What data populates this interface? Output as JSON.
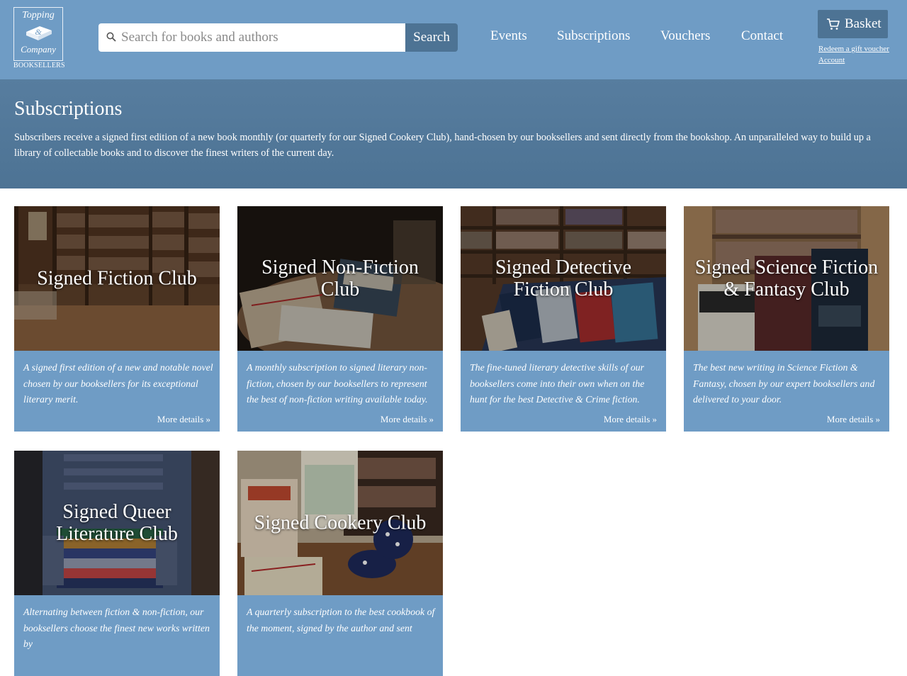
{
  "brand": {
    "logo_line1": "Topping",
    "logo_line2": "Company",
    "logo_sub": "BOOKSELLERS"
  },
  "search": {
    "placeholder": "Search for books and authors",
    "button": "Search"
  },
  "nav": {
    "events": "Events",
    "subscriptions": "Subscriptions",
    "vouchers": "Vouchers",
    "contact": "Contact"
  },
  "account": {
    "basket": "Basket",
    "redeem": "Redeem a gift voucher",
    "account": "Account"
  },
  "banner": {
    "title": "Subscriptions",
    "text": "Subscribers receive a signed first edition of a new book monthly (or quarterly for our Signed Cookery Club), hand-chosen by our booksellers and sent directly from the bookshop. An unparalleled way to build up a library of collectable books and to discover the finest writers of the current day."
  },
  "cards": [
    {
      "title": "Signed Fiction Club",
      "desc": "A signed first edition of a new and notable novel chosen by our booksellers for its exceptional literary merit.",
      "more": "More details »"
    },
    {
      "title": "Signed Non-Fiction Club",
      "desc": "A monthly subscription to signed literary non-fiction, chosen by our booksellers to represent the best of non-fiction writing available today.",
      "more": "More details »"
    },
    {
      "title": "Signed Detective Fiction Club",
      "desc": "The fine-tuned literary detective skills of our booksellers come into their own when on the hunt for the best Detective & Crime fiction.",
      "more": "More details »"
    },
    {
      "title": "Signed Science Fiction & Fantasy Club",
      "desc": "The best new writing in Science Fiction & Fantasy, chosen by our expert booksellers and delivered to your door.",
      "more": "More details »"
    },
    {
      "title": "Signed Queer Literature Club",
      "desc": "Alternating between fiction & non-fiction, our booksellers choose the finest new works written by",
      "more": ""
    },
    {
      "title": "Signed Cookery Club",
      "desc": "A quarterly subscription to the best cookbook of the moment, signed by the author and sent",
      "more": ""
    }
  ]
}
